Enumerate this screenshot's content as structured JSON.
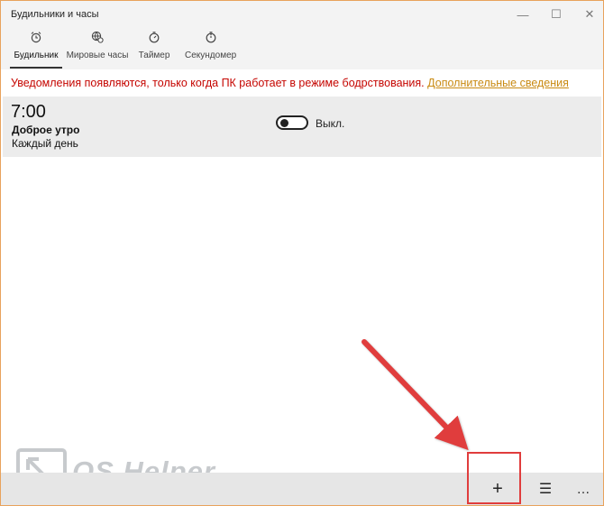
{
  "window": {
    "title": "Будильники и часы"
  },
  "controls": {
    "minimize": "—",
    "maximize": "☐",
    "close": "✕"
  },
  "tabs": [
    {
      "label": "Будильник",
      "icon": "alarm-clock-icon",
      "active": true
    },
    {
      "label": "Мировые часы",
      "icon": "world-clock-icon",
      "active": false
    },
    {
      "label": "Таймер",
      "icon": "timer-icon",
      "active": false
    },
    {
      "label": "Секундомер",
      "icon": "stopwatch-icon",
      "active": false
    }
  ],
  "notice": {
    "text": "Уведомления появляются, только когда ПК работает в режиме бодрствования.",
    "link": "Дополнительные сведения"
  },
  "alarm": {
    "time": "7:00",
    "name": "Доброе утро",
    "repeat": "Каждый день",
    "toggle_label": "Выкл.",
    "enabled": false
  },
  "bottom": {
    "add": "+",
    "select": "☰",
    "more": "…"
  },
  "watermark": {
    "text": "OS Helper"
  },
  "colors": {
    "notice": "#c50500",
    "link": "#c98a12",
    "annotation": "#e03d3d",
    "accent_border": "#e8a25c"
  }
}
